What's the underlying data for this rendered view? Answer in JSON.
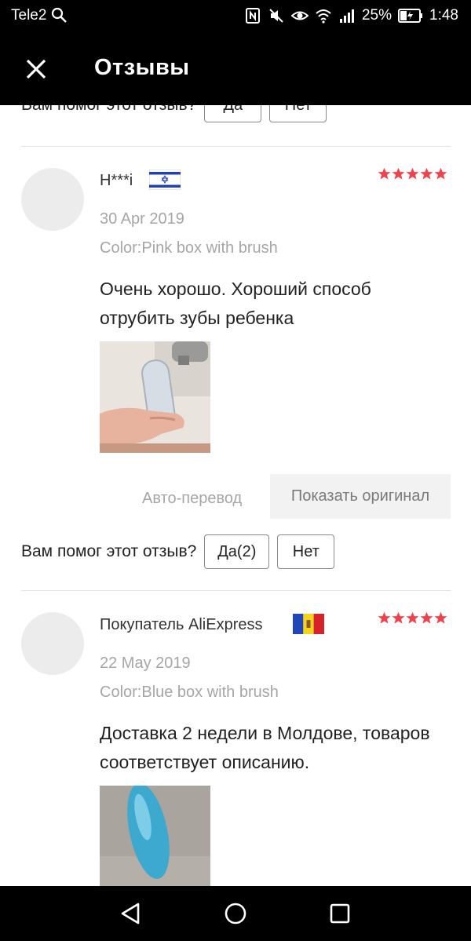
{
  "status_bar": {
    "carrier": "Tele2",
    "battery": "25%",
    "time": "1:48"
  },
  "app_bar": {
    "title": "Отзывы",
    "close_icon": "close-icon"
  },
  "top_helpful": {
    "question": "Вам помог этот отзыв?",
    "yes": "Да",
    "no": "Нет"
  },
  "reviews": [
    {
      "user": "H***i",
      "flag": "israel-flag-icon",
      "rating": 5,
      "date": "30 Apr 2019",
      "color": "Color:Pink box with brush",
      "text": "Очень хорошо. Хороший способ отрубить зубы ребенка",
      "auto_translate": "Авто-перевод",
      "show_original": "Показать оригинал",
      "helpful_question": "Вам помог этот отзыв?",
      "helpful_yes": "Да(2)",
      "helpful_no": "Нет"
    },
    {
      "user": "Покупатель AliExpress",
      "flag": "moldova-flag-icon",
      "rating": 5,
      "date": "22 May 2019",
      "color": "Color:Blue box with brush",
      "text": "Доставка 2 недели в Молдове, товаров соответствует описанию."
    }
  ],
  "colors": {
    "star": "#f0424a",
    "bar": "#000000",
    "muted_text": "#a6a6a6"
  }
}
